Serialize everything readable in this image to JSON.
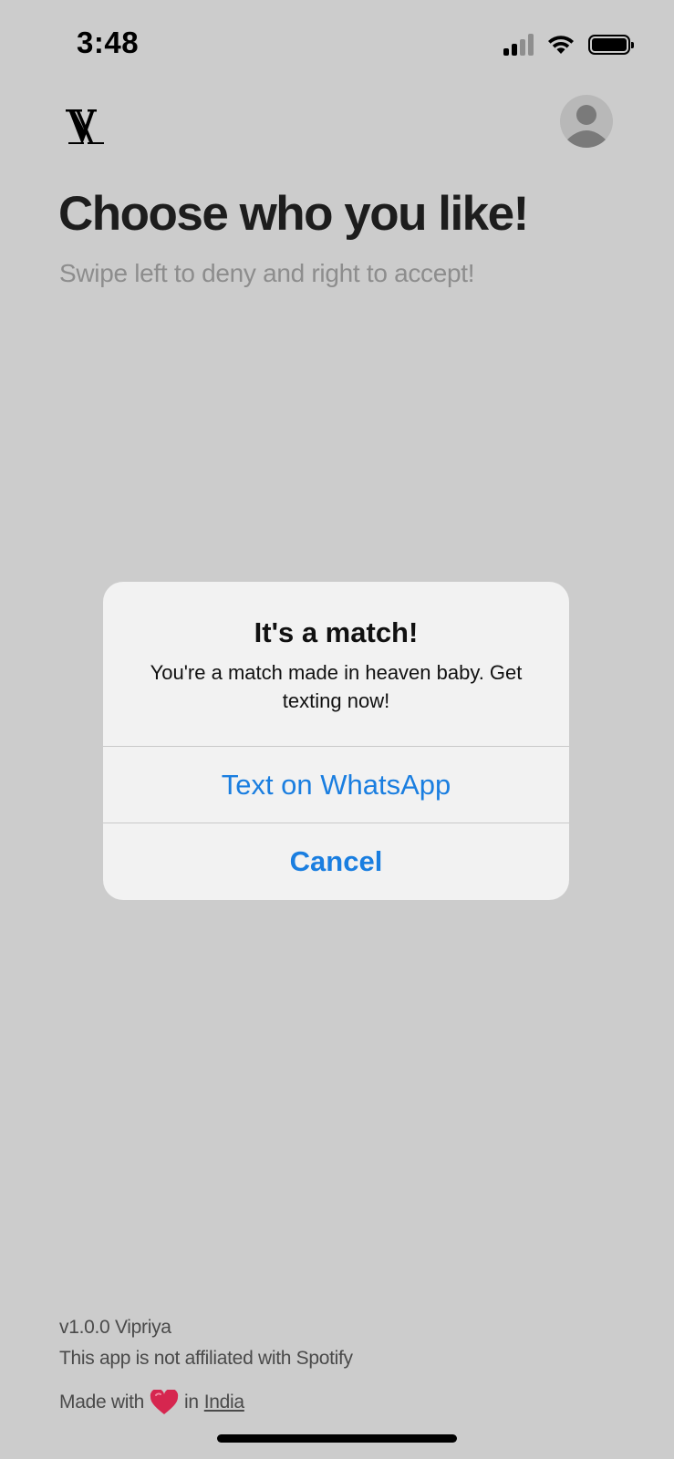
{
  "status_bar": {
    "time": "3:48",
    "icons": [
      "signal-icon",
      "wifi-icon",
      "battery-icon"
    ]
  },
  "header": {
    "logo_icon": "vipriya-logo-icon",
    "avatar_icon": "profile-avatar-icon"
  },
  "page": {
    "title": "Choose who you like!",
    "subtitle": "Swipe left to deny and right to accept!"
  },
  "alert": {
    "title": "It's a match!",
    "message": "You're a match made in heaven baby. Get texting now!",
    "primary_button": "Text on WhatsApp",
    "cancel_button": "Cancel"
  },
  "footer": {
    "version": "v1.0.0 Vipriya",
    "disclaimer": "This app is not affiliated with Spotify",
    "made_with_prefix": "Made with",
    "made_with_in": "in",
    "country_link": "India",
    "heart_icon": "heart-icon"
  },
  "colors": {
    "background": "#cccccc",
    "alert_background": "#f2f2f2",
    "accent_blue": "#1a7ee0",
    "heart": "#d6264f",
    "subtitle_gray": "#8d8d8d"
  }
}
